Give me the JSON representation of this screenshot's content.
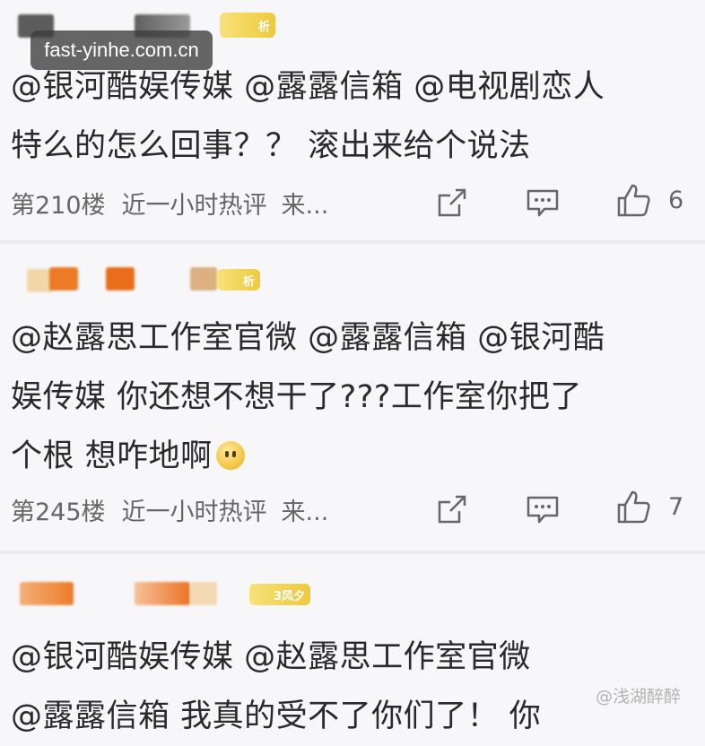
{
  "watermark": "fast-yinhe.com.cn",
  "credit": "@浅湖醉醉",
  "comments": [
    {
      "line1": "@银河酷娱传媒 @露露信箱 @电视剧恋人",
      "line2": "特么的怎么回事？？ 滚出来给个说法",
      "floor": "第210楼",
      "hot": "近一小时热评",
      "source": "来...",
      "likes": "6",
      "badge": "析"
    },
    {
      "line1": "@赵露思工作室官微 @露露信箱 @银河酷",
      "line2": "娱传媒 你还想不想干了???工作室你把了",
      "line3": "个根 想咋地啊",
      "floor": "第245楼",
      "hot": "近一小时热评",
      "source": "来...",
      "likes": "7",
      "badge": "析"
    },
    {
      "line1": "@银河酷娱传媒 @赵露思工作室官微",
      "line2": "@露露信箱 我真的受不了你们了！ 你",
      "badge": "3风夕"
    }
  ],
  "colors": {
    "background": "#f7f7f9",
    "badge": "#eec93c",
    "blur_orange": "#ef7d2c",
    "blur_gray": "#6d6d6d"
  }
}
